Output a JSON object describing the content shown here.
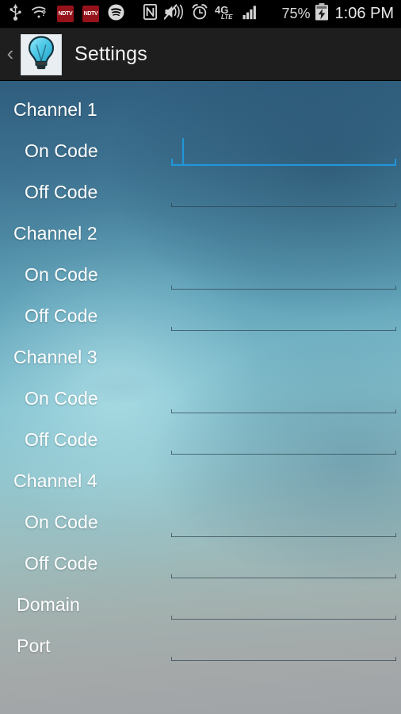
{
  "statusbar": {
    "icons_left": [
      {
        "name": "usb-icon",
        "glyph": "usb"
      },
      {
        "name": "wifi-question-icon",
        "glyph": "wifi-unknown"
      },
      {
        "name": "ndtv-notification-icon-1",
        "label": "NDTV"
      },
      {
        "name": "ndtv-notification-icon-2",
        "label": "NDTV"
      },
      {
        "name": "spotify-icon",
        "glyph": "spotify"
      }
    ],
    "icons_mid": [
      {
        "name": "nfc-icon",
        "glyph": "nfc"
      },
      {
        "name": "volume-mute-icon",
        "glyph": "speaker-muted"
      },
      {
        "name": "alarm-clock-icon",
        "glyph": "alarm"
      },
      {
        "name": "network-4g-lte-icon",
        "label": "4G LTE"
      },
      {
        "name": "signal-bars-icon",
        "glyph": "signal"
      }
    ],
    "battery_percent": "75%",
    "battery_state": "charging",
    "clock": "1:06 PM"
  },
  "actionbar": {
    "back_label": "‹",
    "app_icon_name": "light-bulb-icon",
    "title": "Settings"
  },
  "colors": {
    "accent_focus": "#2196d8",
    "label_text": "#ffffff",
    "field_line": "#2e424e",
    "actionbar_bg": "#1e1e1e",
    "statusbar_bg": "#000000",
    "bulb_cyan": "#5fd4ee"
  },
  "form": {
    "rows": [
      {
        "label": "Channel 1",
        "type": "header",
        "indent": "indent-0"
      },
      {
        "label": "On Code",
        "type": "input",
        "indent": "indent-1",
        "value": "",
        "placeholder": "",
        "focused": true
      },
      {
        "label": "Off Code",
        "type": "input",
        "indent": "indent-1",
        "value": "",
        "placeholder": "",
        "focused": false
      },
      {
        "label": "Channel 2",
        "type": "header",
        "indent": "indent-0"
      },
      {
        "label": "On Code",
        "type": "input",
        "indent": "indent-1",
        "value": "",
        "placeholder": "",
        "focused": false
      },
      {
        "label": "Off Code",
        "type": "input",
        "indent": "indent-1",
        "value": "",
        "placeholder": "",
        "focused": false
      },
      {
        "label": "Channel 3",
        "type": "header",
        "indent": "indent-0"
      },
      {
        "label": "On Code",
        "type": "input",
        "indent": "indent-1",
        "value": "",
        "placeholder": "",
        "focused": false
      },
      {
        "label": "Off Code",
        "type": "input",
        "indent": "indent-1",
        "value": "",
        "placeholder": "",
        "focused": false
      },
      {
        "label": "Channel 4",
        "type": "header",
        "indent": "indent-0"
      },
      {
        "label": "On Code",
        "type": "input",
        "indent": "indent-1",
        "value": "",
        "placeholder": "",
        "focused": false
      },
      {
        "label": "Off Code",
        "type": "input",
        "indent": "indent-1",
        "value": "",
        "placeholder": "",
        "focused": false
      },
      {
        "label": "Domain",
        "type": "input",
        "indent": "indent-d",
        "value": "",
        "placeholder": "",
        "focused": false
      },
      {
        "label": "Port",
        "type": "input",
        "indent": "indent-d",
        "value": "",
        "placeholder": "",
        "focused": false
      }
    ]
  }
}
